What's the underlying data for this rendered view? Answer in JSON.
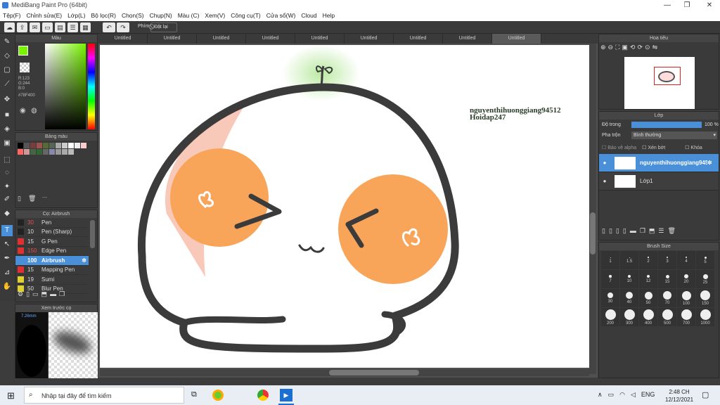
{
  "window": {
    "title": "MediBang Paint Pro (64bit)",
    "min": "—",
    "max": "❐",
    "close": "✕"
  },
  "menu": [
    "Tệp(F)",
    "Chỉnh sửa(E)",
    "Lớp(L)",
    "Bộ lọc(R)",
    "Chọn(S)",
    "Chụp(N)",
    "Màu (C)",
    "Xem(V)",
    "Công cụ(T)",
    "Cửa sổ(W)",
    "Cloud",
    "Help"
  ],
  "toolbar": {
    "shortcut_label": "Phím",
    "reset_label": "Đặt lại"
  },
  "tabs": [
    "Untitled",
    "Untitled",
    "Untitled",
    "Untitled",
    "Untitled",
    "Untitled",
    "Untitled",
    "Untitled",
    "Untitled"
  ],
  "color_panel": {
    "title": "Màu",
    "r": "R:123",
    "g": "G:244",
    "b": "B:0",
    "hex": "#78F400",
    "fg_color": "#78f400"
  },
  "palette_panel": {
    "title": "Bảng màu",
    "swatches": [
      "#000000",
      "#555555",
      "#7a3b3b",
      "#a05050",
      "#556b2f",
      "#556655",
      "#aaaaaa",
      "#cccccc",
      "#ffffff",
      "#eeeeee",
      "#ffcccc",
      "#ff6666",
      "#cc9999",
      "#446644",
      "#336633",
      "#666666",
      "#8888aa",
      "#999999",
      "#aaaaaa",
      "#bbbbbb"
    ],
    "ellipsis": "---"
  },
  "brush_panel": {
    "title": "Cọ: Airbrush",
    "items": [
      {
        "size": "30",
        "name": "Pen",
        "color": "#222222",
        "size_color": "#e05050"
      },
      {
        "size": "10",
        "name": "Pen (Sharp)",
        "color": "#222222",
        "size_color": "#dddddd"
      },
      {
        "size": "15",
        "name": "G Pen",
        "color": "#e03030",
        "size_color": "#dddddd"
      },
      {
        "size": "150",
        "name": "Edge Pen",
        "color": "#e03030",
        "size_color": "#e05050"
      },
      {
        "size": "100",
        "name": "Airbrush",
        "color": "#4a90d9",
        "size_color": "#ffffff",
        "selected": true
      },
      {
        "size": "15",
        "name": "Mapping Pen",
        "color": "#e03030",
        "size_color": "#dddddd"
      },
      {
        "size": "19",
        "name": "Sumi",
        "color": "#e0d030",
        "size_color": "#dddddd"
      },
      {
        "size": "50",
        "name": "Blur Pen",
        "color": "#e0d030",
        "size_color": "#dddddd"
      }
    ]
  },
  "preview_panel": {
    "title": "Xem trước cọ",
    "size": "7.26mm"
  },
  "navigator": {
    "title": "Hoa tiêu"
  },
  "layer_panel": {
    "title": "Lớp",
    "opacity_label": "Độ trong",
    "opacity_value": "100 %",
    "blend_label": "Pha trộn",
    "blend_value": "Bình thường",
    "protect_alpha": "Bảo vệ alpha",
    "clipping": "Xén bớt",
    "lock": "Khóa",
    "layers": [
      {
        "name": "nguyenthihuonggiang94512",
        "selected": true
      },
      {
        "name": "Lớp1",
        "selected": false
      }
    ]
  },
  "brush_size": {
    "title": "Brush Size",
    "sizes": [
      "1",
      "1.5",
      "2",
      "3",
      "4",
      "5",
      "7",
      "10",
      "12",
      "15",
      "20",
      "25",
      "30",
      "40",
      "50",
      "70",
      "100",
      "150",
      "200",
      "300",
      "400",
      "500",
      "700",
      "1000"
    ]
  },
  "canvas_text": {
    "line1": "nguyenthihuonggiang94512",
    "line2": "Hoidap247"
  },
  "taskbar": {
    "search_placeholder": "Nhập tại đây để tìm kiếm",
    "lang": "ENG",
    "time": "2:48 CH",
    "date": "12/12/2021"
  }
}
